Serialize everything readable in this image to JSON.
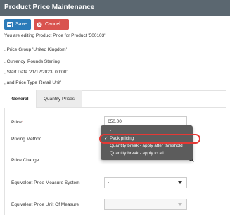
{
  "header": {
    "title": "Product Price Maintenance"
  },
  "toolbar": {
    "save_label": "Save",
    "cancel_label": "Cancel"
  },
  "info": {
    "line1": "You are editing Product Price for Product '500103'",
    "line2": ", Price Group 'United Kingdom'",
    "line3": ", Currency 'Pounds Sterling'",
    "line4": ", Start Date '21/12/2023, 00:00'",
    "line5": ", and Price Type 'Retail Unit'"
  },
  "tabs": [
    {
      "label": "General",
      "active": true
    },
    {
      "label": "Quantity Prices",
      "active": false
    }
  ],
  "form": {
    "price_label": "Price",
    "price_required_mark": "*",
    "price_value": "£50.00",
    "pricing_method_label": "Pricing Method",
    "price_change_label": "Price Change",
    "eq_measure_system_label": "Equivalent Price Measure System",
    "eq_measure_system_value": "-",
    "eq_unit_label": "Equivalent Price Unit Of Measure",
    "eq_unit_value": "-"
  },
  "dropdown": {
    "options": [
      {
        "label": "-",
        "selected": false
      },
      {
        "label": "Pack pricing",
        "selected": true
      },
      {
        "label": "Quantity break - apply after threshold",
        "selected": false
      },
      {
        "label": "Quantity break - apply to all",
        "selected": false
      }
    ],
    "check_glyph": "✓"
  },
  "colors": {
    "title_bar": "#5b6770",
    "save": "#2b7bb9",
    "cancel": "#d9534f",
    "dropdown_bg": "#5c5c5c",
    "highlight": "#e53935"
  }
}
